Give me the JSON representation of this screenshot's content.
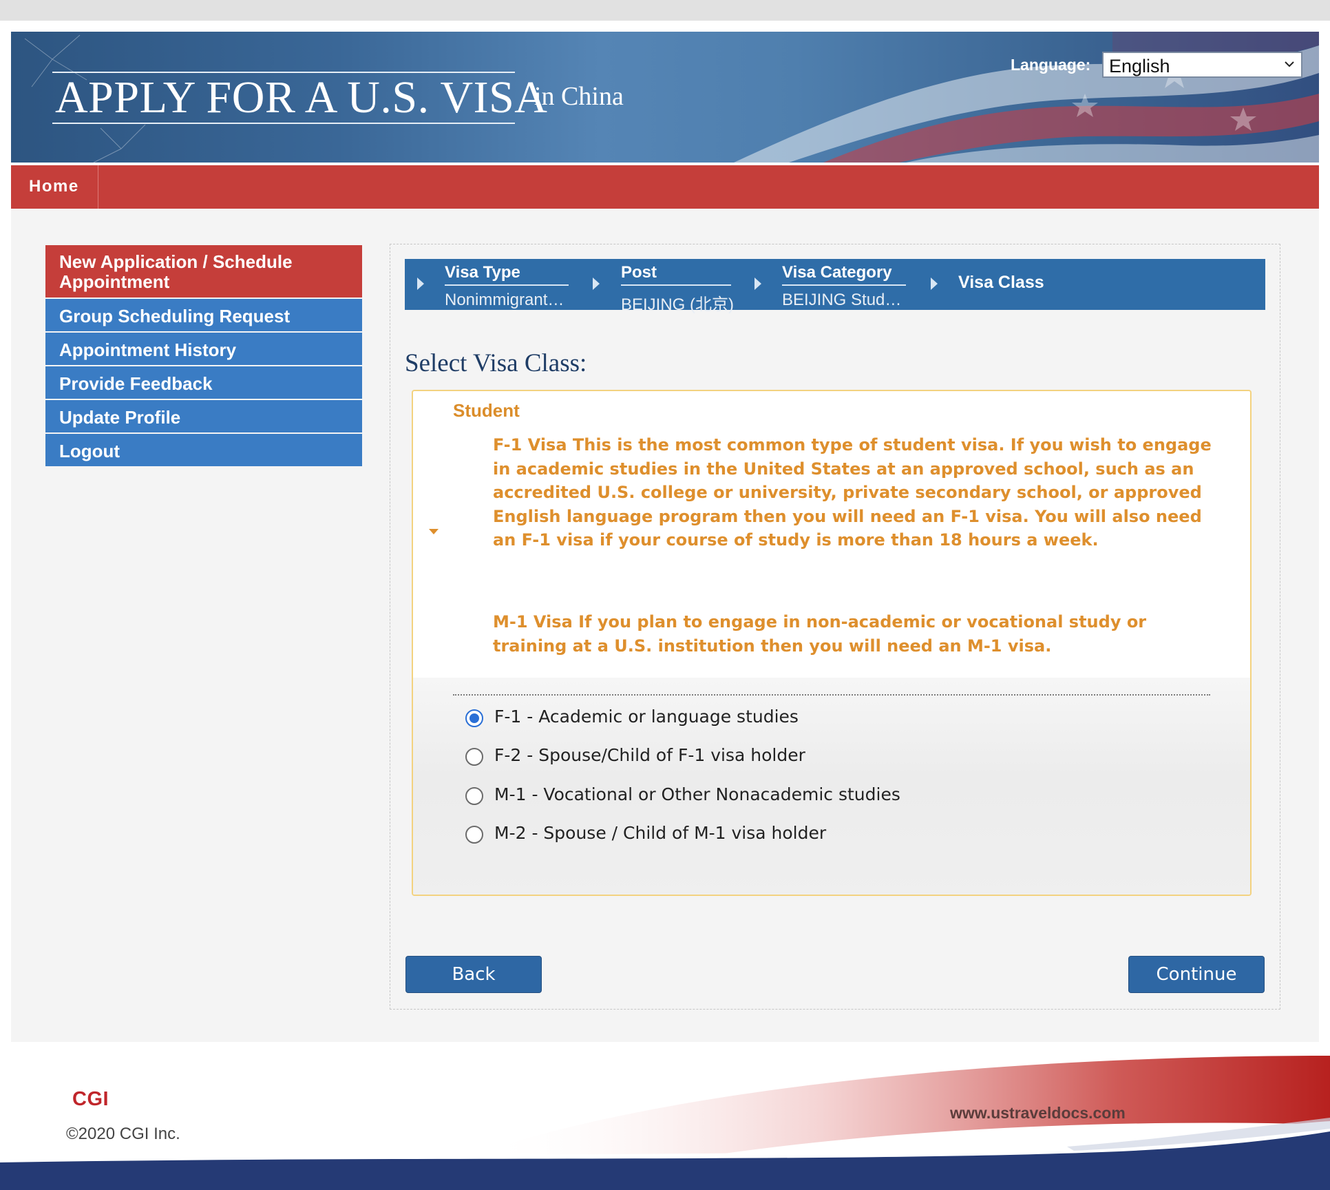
{
  "header": {
    "title": "APPLY FOR A U.S. VISA",
    "country": "in  China",
    "language_label": "Language:",
    "language_selected": "English"
  },
  "nav": {
    "home": "Home"
  },
  "sidebar": {
    "items": [
      {
        "label": "New Application / Schedule Appointment",
        "active": true
      },
      {
        "label": "Group Scheduling Request"
      },
      {
        "label": "Appointment History"
      },
      {
        "label": "Provide Feedback"
      },
      {
        "label": "Update Profile"
      },
      {
        "label": "Logout"
      }
    ]
  },
  "breadcrumb": {
    "steps": [
      {
        "label": "Visa Type",
        "value": "Nonimmigrant…"
      },
      {
        "label": "Post",
        "value": "BEIJING (北京)"
      },
      {
        "label": "Visa Category",
        "value": "BEIJING Stud…"
      },
      {
        "label": "Visa Class"
      }
    ]
  },
  "main": {
    "section_title": "Select Visa Class:",
    "category": "Student",
    "descriptions": [
      "F-1 Visa This is the most common type of student visa. If you wish  to engage in academic studies in the United States at an approved school, such as an accredited U.S. college or university, private secondary school, or approved English language program then you will need an F-1 visa. You will also need an F-1 visa if your course of study is more than 18 hours a week.",
      "M-1 Visa If you plan to engage in non-academic or vocational study or training at a U.S. institution then you will need an M-1 visa."
    ],
    "options": [
      {
        "label": "F-1 - Academic or language studies",
        "checked": true
      },
      {
        "label": "F-2 - Spouse/Child of F-1 visa holder",
        "checked": false
      },
      {
        "label": "M-1 - Vocational or Other Nonacademic studies",
        "checked": false
      },
      {
        "label": "M-2 - Spouse / Child of M-1 visa holder",
        "checked": false
      }
    ],
    "back_label": "Back",
    "continue_label": "Continue"
  },
  "footer": {
    "logo": "CGI",
    "copyright": "©2020 CGI Inc.",
    "url": "www.ustraveldocs.com"
  },
  "colors": {
    "nav_red": "#c53e3a",
    "menu_blue": "#3a7cc4",
    "crumb_blue": "#2f6da8",
    "accent_orange": "#de8f2d",
    "button_blue": "#2e67a4"
  }
}
